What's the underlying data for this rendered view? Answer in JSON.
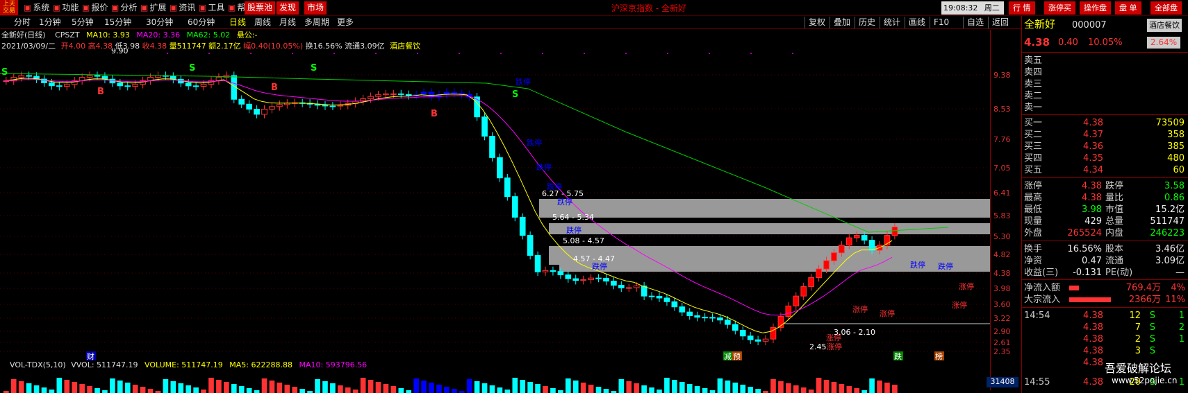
{
  "top_menu": {
    "logo": "上天\n交易",
    "items": [
      "系统",
      "功能",
      "报价",
      "分析",
      "扩展",
      "资讯",
      "工具",
      "帮助"
    ],
    "red_items": [
      "股票池",
      "发现",
      "市场"
    ],
    "center_title": "沪深京指数 - 全新好",
    "clock": "19:08:32",
    "weekday": "周二",
    "right_buttons": [
      "行 情",
      "涨停买",
      "操作盘",
      "盘 单",
      "全部盘"
    ]
  },
  "periods": [
    "分时",
    "1分钟",
    "5分钟",
    "15分钟",
    "30分钟",
    "60分钟",
    "日线",
    "周线",
    "月线",
    "多周期",
    "更多"
  ],
  "active_period": "日线",
  "tools": [
    "复权",
    "叠加",
    "历史",
    "统计",
    "画线",
    "F10",
    "自选",
    "返回"
  ],
  "tools_prefix": [
    "◆",
    "+"
  ],
  "stock_header": {
    "title": "全新好(日线)",
    "code": "CPSZT",
    "ma10": "MA10: 3.93",
    "ma20": "MA20: 3.36",
    "ma62": "MA62: 5.02",
    "extra": "悬公:-",
    "line2_date": "2021/03/09/二",
    "open": "开4.00",
    "high": "高4.38",
    "low": "低3.98",
    "close": "收4.38",
    "vol": "量511747",
    "amount": "额2.17亿",
    "change": "幅0.40(10.05%)",
    "turnover": "换16.56%",
    "float": "流通3.09亿",
    "industry": "酒店餐饮"
  },
  "chart_data": {
    "type": "candlestick",
    "y_ticks": [
      "9.38",
      "8.53",
      "7.76",
      "7.05",
      "6.41",
      "5.83",
      "5.30",
      "4.82",
      "4.38",
      "3.98",
      "3.60",
      "3.22",
      "2.90",
      "2.61",
      "2.35"
    ],
    "annotations": [
      "9.90",
      "2.45",
      "跌停",
      "涨停",
      "跌停",
      "跌停",
      "跌停",
      "跌停",
      "跌停",
      "跌停",
      "涨停",
      "涨停",
      "涨停",
      "跌停",
      "跌停",
      "涨停",
      "涨停"
    ],
    "gaps": [
      "6.27 - 5.75",
      "5.64 - 5.34",
      "5.08 - 4.57",
      "4.57 - 4.47",
      "3.06 - 2.10"
    ],
    "markers_bottom": [
      "财",
      "减",
      "预",
      "跌",
      "榜"
    ],
    "signals": [
      "S",
      "B",
      "B",
      "S",
      "S",
      "B",
      "S"
    ]
  },
  "volume_bar": {
    "name": "VOL-TDX(5,10)",
    "vvol": "VVOL: 511747.19",
    "volume": "VOLUME: 511747.19",
    "ma5": "MA5: 622288.88",
    "ma10": "MA10: 593796.56",
    "axis_label": "31408"
  },
  "right_panel": {
    "name": "全新好",
    "code": "000007",
    "sector": "酒店餐饮",
    "price": "4.38",
    "change": "0.40",
    "pct": "10.05%",
    "amp_badge": "2.64%",
    "sells": [
      {
        "label": "卖五",
        "price": "",
        "vol": ""
      },
      {
        "label": "卖四",
        "price": "",
        "vol": ""
      },
      {
        "label": "卖三",
        "price": "",
        "vol": ""
      },
      {
        "label": "卖二",
        "price": "",
        "vol": ""
      },
      {
        "label": "卖一",
        "price": "",
        "vol": ""
      }
    ],
    "buys": [
      {
        "label": "买一",
        "price": "4.38",
        "vol": "73509"
      },
      {
        "label": "买二",
        "price": "4.37",
        "vol": "358"
      },
      {
        "label": "买三",
        "price": "4.36",
        "vol": "385"
      },
      {
        "label": "买四",
        "price": "4.35",
        "vol": "480"
      },
      {
        "label": "买五",
        "price": "4.34",
        "vol": "60"
      }
    ],
    "stats": [
      {
        "l1": "涨停",
        "v1": "4.38",
        "l2": "跌停",
        "v2": "3.58"
      },
      {
        "l1": "最高",
        "v1": "4.38",
        "l2": "量比",
        "v2": "0.86"
      },
      {
        "l1": "最低",
        "v1": "3.98",
        "l2": "市值",
        "v2": "15.2亿"
      },
      {
        "l1": "现量",
        "v1": "429",
        "l2": "总量",
        "v2": "511747"
      },
      {
        "l1": "外盘",
        "v1": "265524",
        "l2": "内盘",
        "v2": "246223"
      }
    ],
    "stats2": [
      {
        "l1": "换手",
        "v1": "16.56%",
        "l2": "股本",
        "v2": "3.46亿"
      },
      {
        "l1": "净资",
        "v1": "0.47",
        "l2": "流通",
        "v2": "3.09亿"
      },
      {
        "l1": "收益(三)",
        "v1": "-0.131",
        "l2": "PE(动)",
        "v2": "—"
      }
    ],
    "flows": [
      {
        "label": "净流入额",
        "value": "769.4万",
        "pct": "4%"
      },
      {
        "label": "大宗流入",
        "value": "2366万",
        "pct": "11%"
      }
    ],
    "ticks": [
      {
        "time": "14:54",
        "price": "4.38",
        "vol": "12",
        "side": "S",
        "n": "1"
      },
      {
        "time": "",
        "price": "4.38",
        "vol": "7",
        "side": "S",
        "n": "2"
      },
      {
        "time": "",
        "price": "4.38",
        "vol": "2",
        "side": "S",
        "n": "1"
      },
      {
        "time": "",
        "price": "4.38",
        "vol": "3",
        "side": "S",
        "n": ""
      },
      {
        "time": "",
        "price": "4.38",
        "vol": "",
        "side": "",
        "n": ""
      },
      {
        "time": "14:55",
        "price": "4.38",
        "vol": "20",
        "side": "S",
        "n": "1"
      }
    ]
  },
  "watermark": {
    "line1": "吾爱破解论坛",
    "line2": "www.52pojie.cn"
  }
}
